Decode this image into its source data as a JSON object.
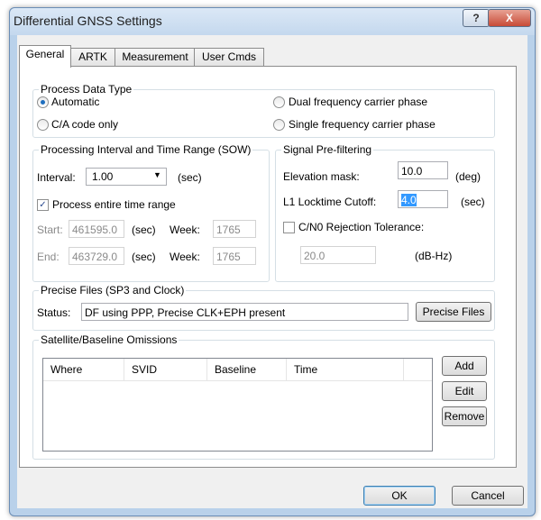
{
  "window": {
    "title": "Differential GNSS Settings",
    "help_label": "?",
    "close_label": "X"
  },
  "tabs": [
    "General",
    "ARTK",
    "Measurement",
    "User Cmds"
  ],
  "process_data_type": {
    "label": "Process Data Type",
    "options": [
      "Automatic",
      "C/A code only",
      "Dual frequency carrier phase",
      "Single frequency carrier phase"
    ],
    "selected": "Automatic"
  },
  "processing_interval": {
    "label": "Processing Interval and Time Range (SOW)",
    "interval_label": "Interval:",
    "interval_value": "1.00",
    "interval_unit": "(sec)",
    "process_entire_label": "Process entire time range",
    "process_entire_checked": true,
    "start_label": "Start:",
    "start_value": "461595.0",
    "end_label": "End:",
    "end_value": "463729.0",
    "sec_unit": "(sec)",
    "week_label": "Week:",
    "start_week": "1765",
    "end_week": "1765"
  },
  "signal_prefiltering": {
    "label": "Signal Pre-filtering",
    "elevation_label": "Elevation mask:",
    "elevation_value": "10.0",
    "elevation_unit": "(deg)",
    "locktime_label": "L1 Locktime Cutoff:",
    "locktime_value": "4.0",
    "locktime_unit": "(sec)",
    "cn0_label": "C/N0 Rejection Tolerance:",
    "cn0_checked": false,
    "cn0_value": "20.0",
    "cn0_unit": "(dB-Hz)"
  },
  "precise_files": {
    "label": "Precise Files (SP3 and Clock)",
    "status_label": "Status:",
    "status_value": "DF using PPP, Precise CLK+EPH present",
    "button_label": "Precise Files"
  },
  "omissions": {
    "label": "Satellite/Baseline Omissions",
    "columns": [
      "Where",
      "SVID",
      "Baseline",
      "Time"
    ],
    "add_label": "Add",
    "edit_label": "Edit",
    "remove_label": "Remove"
  },
  "footer": {
    "ok_label": "OK",
    "cancel_label": "Cancel"
  }
}
